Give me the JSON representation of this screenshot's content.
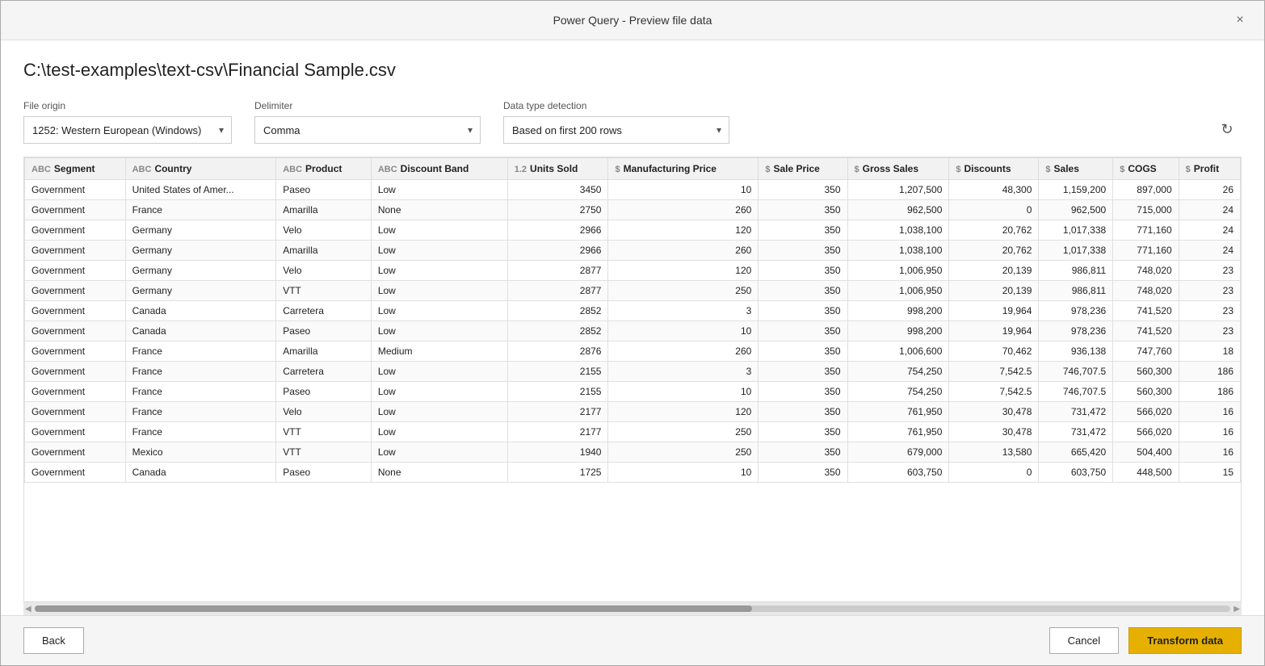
{
  "dialog": {
    "title": "Power Query - Preview file data",
    "close_label": "×"
  },
  "file_path": "C:\\test-examples\\text-csv\\Financial Sample.csv",
  "options": {
    "file_origin_label": "File origin",
    "file_origin_value": "1252: Western European (Windows)",
    "delimiter_label": "Delimiter",
    "delimiter_value": "Comma",
    "data_type_label": "Data type detection",
    "data_type_value": "Based on first 200 rows"
  },
  "columns": [
    {
      "type": "ABC",
      "name": "Segment"
    },
    {
      "type": "ABC",
      "name": "Country"
    },
    {
      "type": "ABC",
      "name": "Product"
    },
    {
      "type": "ABC",
      "name": "Discount Band"
    },
    {
      "type": "1.2",
      "name": "Units Sold"
    },
    {
      "type": "$",
      "name": "Manufacturing Price"
    },
    {
      "type": "$",
      "name": "Sale Price"
    },
    {
      "type": "$",
      "name": "Gross Sales"
    },
    {
      "type": "$",
      "name": "Discounts"
    },
    {
      "type": "$",
      "name": "Sales"
    },
    {
      "type": "$",
      "name": "COGS"
    },
    {
      "type": "$",
      "name": "Profit"
    }
  ],
  "rows": [
    [
      "Government",
      "United States of Amer...",
      "Paseo",
      "Low",
      "3450",
      "10",
      "350",
      "1,207,500",
      "48,300",
      "1,159,200",
      "897,000",
      "26"
    ],
    [
      "Government",
      "France",
      "Amarilla",
      "None",
      "2750",
      "260",
      "350",
      "962,500",
      "0",
      "962,500",
      "715,000",
      "24"
    ],
    [
      "Government",
      "Germany",
      "Velo",
      "Low",
      "2966",
      "120",
      "350",
      "1,038,100",
      "20,762",
      "1,017,338",
      "771,160",
      "24"
    ],
    [
      "Government",
      "Germany",
      "Amarilla",
      "Low",
      "2966",
      "260",
      "350",
      "1,038,100",
      "20,762",
      "1,017,338",
      "771,160",
      "24"
    ],
    [
      "Government",
      "Germany",
      "Velo",
      "Low",
      "2877",
      "120",
      "350",
      "1,006,950",
      "20,139",
      "986,811",
      "748,020",
      "23"
    ],
    [
      "Government",
      "Germany",
      "VTT",
      "Low",
      "2877",
      "250",
      "350",
      "1,006,950",
      "20,139",
      "986,811",
      "748,020",
      "23"
    ],
    [
      "Government",
      "Canada",
      "Carretera",
      "Low",
      "2852",
      "3",
      "350",
      "998,200",
      "19,964",
      "978,236",
      "741,520",
      "23"
    ],
    [
      "Government",
      "Canada",
      "Paseo",
      "Low",
      "2852",
      "10",
      "350",
      "998,200",
      "19,964",
      "978,236",
      "741,520",
      "23"
    ],
    [
      "Government",
      "France",
      "Amarilla",
      "Medium",
      "2876",
      "260",
      "350",
      "1,006,600",
      "70,462",
      "936,138",
      "747,760",
      "18"
    ],
    [
      "Government",
      "France",
      "Carretera",
      "Low",
      "2155",
      "3",
      "350",
      "754,250",
      "7,542.5",
      "746,707.5",
      "560,300",
      "186"
    ],
    [
      "Government",
      "France",
      "Paseo",
      "Low",
      "2155",
      "10",
      "350",
      "754,250",
      "7,542.5",
      "746,707.5",
      "560,300",
      "186"
    ],
    [
      "Government",
      "France",
      "Velo",
      "Low",
      "2177",
      "120",
      "350",
      "761,950",
      "30,478",
      "731,472",
      "566,020",
      "16"
    ],
    [
      "Government",
      "France",
      "VTT",
      "Low",
      "2177",
      "250",
      "350",
      "761,950",
      "30,478",
      "731,472",
      "566,020",
      "16"
    ],
    [
      "Government",
      "Mexico",
      "VTT",
      "Low",
      "1940",
      "250",
      "350",
      "679,000",
      "13,580",
      "665,420",
      "504,400",
      "16"
    ],
    [
      "Government",
      "Canada",
      "Paseo",
      "None",
      "1725",
      "10",
      "350",
      "603,750",
      "0",
      "603,750",
      "448,500",
      "15"
    ]
  ],
  "footer": {
    "back_label": "Back",
    "cancel_label": "Cancel",
    "transform_label": "Transform data"
  }
}
